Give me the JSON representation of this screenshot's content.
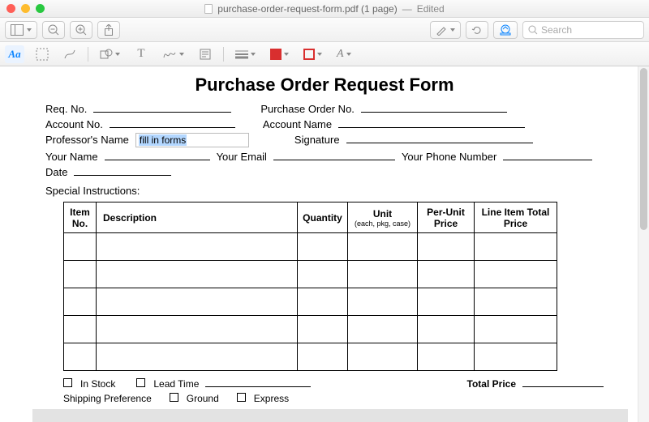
{
  "window": {
    "title": "purchase-order-request-form.pdf (1 page)",
    "edited": "Edited"
  },
  "toolbar": {
    "search_placeholder": "Search"
  },
  "markup_tools": {
    "text_tool": "Aa",
    "letter_T": "T",
    "font_A": "A"
  },
  "form": {
    "title": "Purchase Order Request Form",
    "req_no": "Req. No.",
    "purchase_order_no": "Purchase Order No.",
    "account_no": "Account No.",
    "account_name": "Account Name",
    "professor_name": "Professor's Name",
    "professor_value": "fill in forms",
    "signature": "Signature",
    "your_name": "Your Name",
    "your_email": "Your Email",
    "your_phone": "Your Phone Number",
    "date": "Date",
    "special_instructions": "Special Instructions:",
    "headers": {
      "item_no": "Item No.",
      "description": "Description",
      "quantity": "Quantity",
      "unit": "Unit",
      "unit_sub": "(each, pkg, case)",
      "per_unit_price": "Per-Unit Price",
      "line_total": "Line Item Total Price"
    },
    "footer": {
      "in_stock": "In Stock",
      "lead_time": "Lead Time",
      "total_price": "Total Price",
      "shipping_preference": "Shipping Preference",
      "ground": "Ground",
      "express": "Express"
    }
  }
}
